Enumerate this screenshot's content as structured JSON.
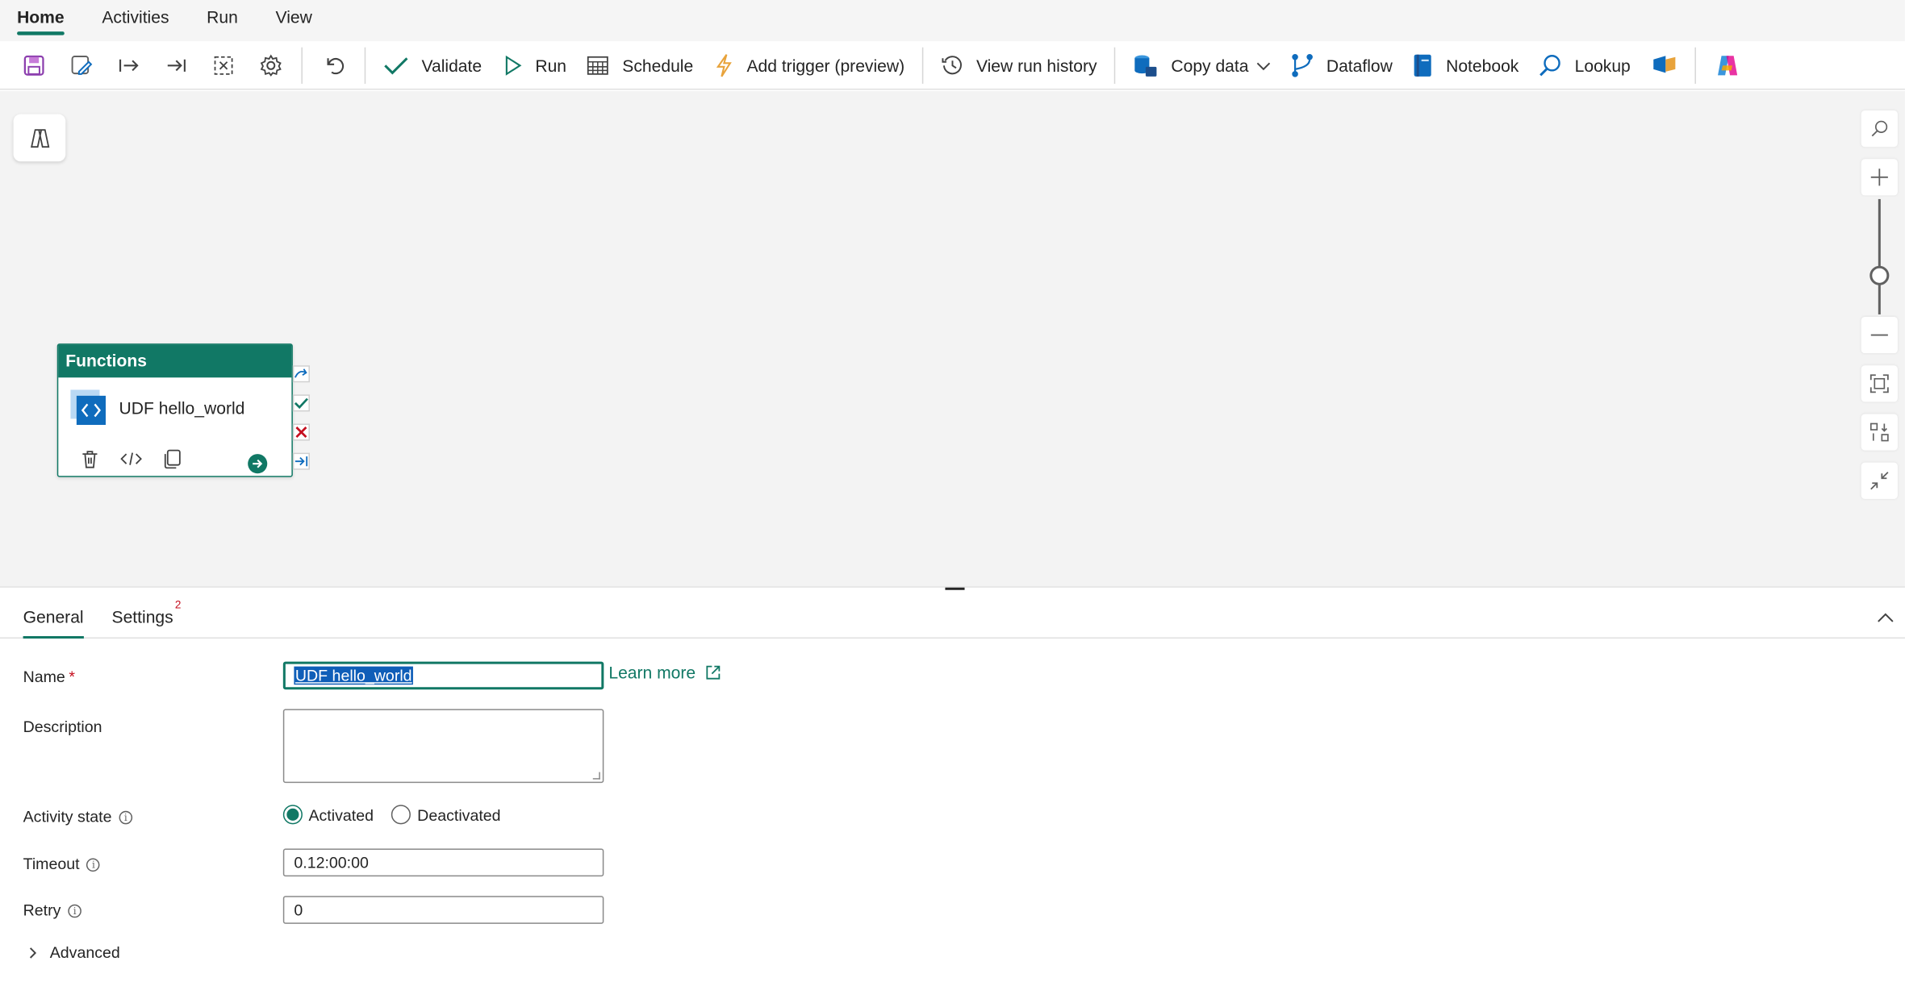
{
  "menu": {
    "tabs": [
      {
        "label": "Home"
      },
      {
        "label": "Activities"
      },
      {
        "label": "Run"
      },
      {
        "label": "View"
      }
    ]
  },
  "toolbar": {
    "validate_label": "Validate",
    "run_label": "Run",
    "schedule_label": "Schedule",
    "add_trigger_label": "Add trigger (preview)",
    "view_run_history_label": "View run history",
    "copy_data_label": "Copy data",
    "dataflow_label": "Dataflow",
    "notebook_label": "Notebook",
    "lookup_label": "Lookup"
  },
  "canvas": {
    "activity": {
      "category": "Functions",
      "name": "UDF hello_world"
    }
  },
  "panel": {
    "tabs": [
      {
        "label": "General"
      },
      {
        "label": "Settings"
      }
    ],
    "settings_badge": "2",
    "fields": {
      "name_label": "Name",
      "required_mark": "*",
      "name_value": "UDF hello_world",
      "learn_more": "Learn more",
      "description_label": "Description",
      "activity_state_label": "Activity state",
      "activated_label": "Activated",
      "deactivated_label": "Deactivated",
      "timeout_label": "Timeout",
      "timeout_value": "0.12:00:00",
      "retry_label": "Retry",
      "retry_value": "0",
      "advanced_label": "Advanced"
    }
  },
  "colors": {
    "accent": "#117865",
    "error": "#c50f1f",
    "selection": "#0f5eb8"
  }
}
